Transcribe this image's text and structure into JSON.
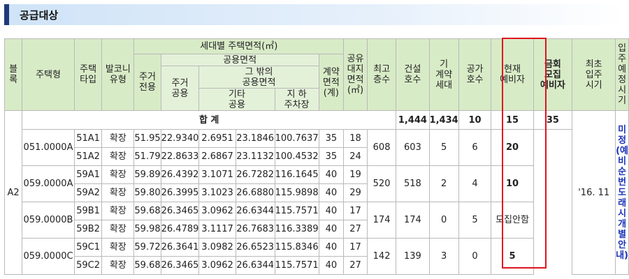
{
  "section": {
    "title": "공급대상"
  },
  "headers": {
    "block": "블\n록",
    "housing_type": "주택형",
    "type": "주택\n타입",
    "balcony": "발코니\n유형",
    "area_group": "세대별 주택면적(㎡)",
    "exclusive": "주거\n전용",
    "common_group": "공용면적",
    "residential_common": "주거\n공용",
    "other_common_group": "그 밖의\n공용면적",
    "other": "기타\n공용",
    "parking": "지  하\n주차장",
    "contract_area": "계약\n면적\n(계)",
    "land_share": "공유\n대지\n면적\n(㎡)",
    "top_floor": "최고\n층수",
    "built_units": "건설\n호수",
    "contracted": "기\n계약\n세대",
    "vacant": "공가\n호수",
    "current_reserve": "현재\n예비자",
    "recruit": "금회\n모집\n예비자",
    "move_in_first": "최초\n입주\n시기",
    "move_in_planned": "입주\n예정\n시기"
  },
  "block": "A2",
  "total": {
    "label": "합 계",
    "built": "1,444",
    "contracted": "1,434",
    "vacant": "10",
    "reserve": "15",
    "recruit": "35"
  },
  "first_move_in": "'16. 11",
  "planned_move_in": "미정\n(예비순번\n도래시\n개별안내)",
  "groups": [
    {
      "house_type": "051.0000A",
      "built": "608",
      "contracted": "603",
      "vacant": "5",
      "reserve": "6",
      "recruit": "20",
      "rows": [
        {
          "type": "51A1",
          "balcony": "확장",
          "exclusive": "51.95",
          "residential": "22.9340",
          "other": "2.6951",
          "parking": "23.1846",
          "contract": "100.7637",
          "land": "35",
          "floors": "18"
        },
        {
          "type": "51A2",
          "balcony": "확장",
          "exclusive": "51.79",
          "residential": "22.8633",
          "other": "2.6867",
          "parking": "23.1132",
          "contract": "100.4532",
          "land": "35",
          "floors": "24"
        }
      ]
    },
    {
      "house_type": "059.0000A",
      "built": "520",
      "contracted": "518",
      "vacant": "2",
      "reserve": "4",
      "recruit": "10",
      "rows": [
        {
          "type": "59A1",
          "balcony": "확장",
          "exclusive": "59.89",
          "residential": "26.4392",
          "other": "3.1071",
          "parking": "26.7282",
          "contract": "116.1645",
          "land": "40",
          "floors": "19"
        },
        {
          "type": "59A2",
          "balcony": "확장",
          "exclusive": "59.80",
          "residential": "26.3995",
          "other": "3.1023",
          "parking": "26.6880",
          "contract": "115.9898",
          "land": "40",
          "floors": "29"
        }
      ]
    },
    {
      "house_type": "059.0000B",
      "built": "174",
      "contracted": "174",
      "vacant": "0",
      "reserve": "5",
      "recruit": "모집안함",
      "rows": [
        {
          "type": "59B1",
          "balcony": "확장",
          "exclusive": "59.68",
          "residential": "26.3465",
          "other": "3.0962",
          "parking": "26.6344",
          "contract": "115.7571",
          "land": "40",
          "floors": "17"
        },
        {
          "type": "59B2",
          "balcony": "확장",
          "exclusive": "59.98",
          "residential": "26.4789",
          "other": "3.1117",
          "parking": "26.7683",
          "contract": "116.3389",
          "land": "40",
          "floors": "27"
        }
      ]
    },
    {
      "house_type": "059.0000C",
      "built": "142",
      "contracted": "139",
      "vacant": "3",
      "reserve": "0",
      "recruit": "5",
      "rows": [
        {
          "type": "59C1",
          "balcony": "확장",
          "exclusive": "59.72",
          "residential": "26.3641",
          "other": "3.0982",
          "parking": "26.6523",
          "contract": "115.8346",
          "land": "40",
          "floors": "17"
        },
        {
          "type": "59C2",
          "balcony": "확장",
          "exclusive": "59.68",
          "residential": "26.3465",
          "other": "3.0962",
          "parking": "26.6344",
          "contract": "115.7571",
          "land": "40",
          "floors": "27"
        }
      ]
    }
  ]
}
